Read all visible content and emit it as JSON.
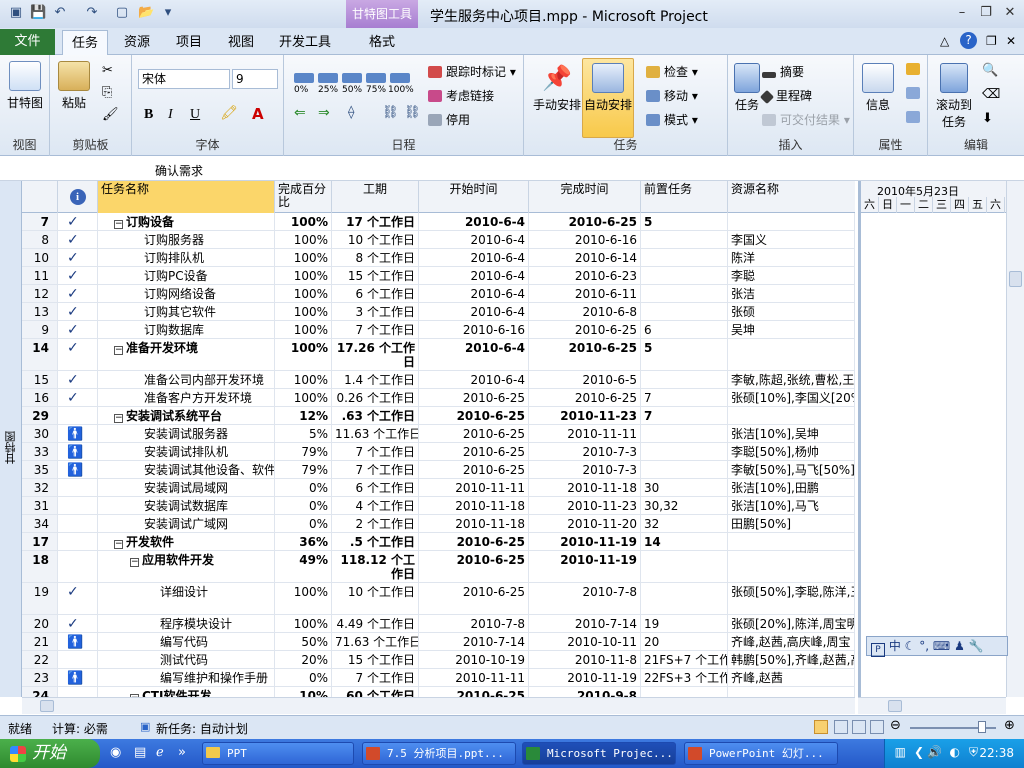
{
  "window": {
    "title": "学生服务中心项目.mpp  -  Microsoft Project",
    "tool_tab": "甘特图工具",
    "minimize": "–",
    "restore": "❐",
    "close": "✕"
  },
  "tabs": {
    "file": "文件",
    "items": [
      "任务",
      "资源",
      "项目",
      "视图",
      "开发工具",
      "格式"
    ],
    "active": "任务"
  },
  "ribbon": {
    "view_group": {
      "label": "视图",
      "gantt": "甘特图"
    },
    "clipboard_group": {
      "label": "剪贴板",
      "paste": "粘贴"
    },
    "font_group": {
      "label": "字体",
      "font_name": "宋体",
      "font_size": "9",
      "bold": "B",
      "italic": "I",
      "underline": "U"
    },
    "schedule_group": {
      "label": "日程",
      "pct": [
        "0%",
        "25%",
        "50%",
        "75%",
        "100%"
      ],
      "track": "跟踪时标记",
      "respect_links": "考虑链接",
      "inactivate": "停用"
    },
    "tasks_group": {
      "label": "任务",
      "manual": "手动安排",
      "auto": "自动安排",
      "inspect": "检查",
      "move": "移动",
      "mode": "模式"
    },
    "insert_group": {
      "label": "插入",
      "task": "任务",
      "summary": "摘要",
      "milestone": "里程碑",
      "deliverable": "可交付结果"
    },
    "properties_group": {
      "label": "属性",
      "info": "信息"
    },
    "editing_group": {
      "label": "编辑",
      "scroll": "滚动到",
      "scroll2": "任务"
    }
  },
  "entry_bar": {
    "value": "确认需求"
  },
  "side_label": "甘特图",
  "columns": [
    "任务名称",
    "完成百分比",
    "工期",
    "开始时间",
    "完成时间",
    "前置任务",
    "资源名称"
  ],
  "gantt": {
    "week": "2010年5月23日",
    "days": [
      "六",
      "日",
      "一",
      "二",
      "三",
      "四",
      "五",
      "六"
    ]
  },
  "rows": [
    {
      "id": "7",
      "ind": "check",
      "name": "订购设备",
      "lvl": 1,
      "sum": true,
      "pct": "100%",
      "dur": "17 个工作日",
      "start": "2010-6-4",
      "finish": "2010-6-25",
      "pred": "5",
      "res": "",
      "h": 18
    },
    {
      "id": "8",
      "ind": "check",
      "name": "订购服务器",
      "lvl": 2,
      "sum": false,
      "pct": "100%",
      "dur": "10 个工作日",
      "start": "2010-6-4",
      "finish": "2010-6-16",
      "pred": "",
      "res": "李国义",
      "h": 18
    },
    {
      "id": "10",
      "ind": "check",
      "name": "订购排队机",
      "lvl": 2,
      "sum": false,
      "pct": "100%",
      "dur": "8 个工作日",
      "start": "2010-6-4",
      "finish": "2010-6-14",
      "pred": "",
      "res": "陈洋",
      "h": 18
    },
    {
      "id": "11",
      "ind": "check",
      "name": "订购PC设备",
      "lvl": 2,
      "sum": false,
      "pct": "100%",
      "dur": "15 个工作日",
      "start": "2010-6-4",
      "finish": "2010-6-23",
      "pred": "",
      "res": "李聪",
      "h": 18
    },
    {
      "id": "12",
      "ind": "check",
      "name": "订购网络设备",
      "lvl": 2,
      "sum": false,
      "pct": "100%",
      "dur": "6 个工作日",
      "start": "2010-6-4",
      "finish": "2010-6-11",
      "pred": "",
      "res": "张洁",
      "h": 18
    },
    {
      "id": "13",
      "ind": "check",
      "name": "订购其它软件",
      "lvl": 2,
      "sum": false,
      "pct": "100%",
      "dur": "3 个工作日",
      "start": "2010-6-4",
      "finish": "2010-6-8",
      "pred": "",
      "res": "张硕",
      "h": 18
    },
    {
      "id": "9",
      "ind": "check",
      "name": "订购数据库",
      "lvl": 2,
      "sum": false,
      "pct": "100%",
      "dur": "7 个工作日",
      "start": "2010-6-16",
      "finish": "2010-6-25",
      "pred": "6",
      "res": "吴坤",
      "h": 18
    },
    {
      "id": "14",
      "ind": "check",
      "name": "准备开发环境",
      "lvl": 1,
      "sum": true,
      "pct": "100%",
      "dur": "17.26 个工作日",
      "start": "2010-6-4",
      "finish": "2010-6-25",
      "pred": "5",
      "res": "",
      "h": 32
    },
    {
      "id": "15",
      "ind": "check",
      "name": "准备公司内部开发环境",
      "lvl": 2,
      "sum": false,
      "pct": "100%",
      "dur": "1.4 个工作日",
      "start": "2010-6-4",
      "finish": "2010-6-5",
      "pred": "",
      "res": "李敏,陈超,张统,曹松,王",
      "h": 18
    },
    {
      "id": "16",
      "ind": "check",
      "name": "准备客户方开发环境",
      "lvl": 2,
      "sum": false,
      "pct": "100%",
      "dur": "0.26 个工作日",
      "start": "2010-6-25",
      "finish": "2010-6-25",
      "pred": "7",
      "res": "张硕[10%],李国义[20%]",
      "h": 18
    },
    {
      "id": "29",
      "ind": "",
      "name": "安装调试系统平台",
      "lvl": 1,
      "sum": true,
      "pct": "12%",
      "dur": ".63 个工作日",
      "start": "2010-6-25",
      "finish": "2010-11-23",
      "pred": "7",
      "res": "",
      "h": 18
    },
    {
      "id": "30",
      "ind": "person",
      "name": "安装调试服务器",
      "lvl": 2,
      "sum": false,
      "pct": "5%",
      "dur": "11.63 个工作日",
      "start": "2010-6-25",
      "finish": "2010-11-11",
      "pred": "",
      "res": "张洁[10%],吴坤",
      "h": 18
    },
    {
      "id": "33",
      "ind": "person",
      "name": "安装调试排队机",
      "lvl": 2,
      "sum": false,
      "pct": "79%",
      "dur": "7 个工作日",
      "start": "2010-6-25",
      "finish": "2010-7-3",
      "pred": "",
      "res": "李聪[50%],杨帅",
      "h": 18
    },
    {
      "id": "35",
      "ind": "person",
      "name": "安装调试其他设备、软件",
      "lvl": 2,
      "sum": false,
      "pct": "79%",
      "dur": "7 个工作日",
      "start": "2010-6-25",
      "finish": "2010-7-3",
      "pred": "",
      "res": "李敏[50%],马飞[50%]",
      "h": 18
    },
    {
      "id": "32",
      "ind": "",
      "name": "安装调试局域网",
      "lvl": 2,
      "sum": false,
      "pct": "0%",
      "dur": "6 个工作日",
      "start": "2010-11-11",
      "finish": "2010-11-18",
      "pred": "30",
      "res": "张洁[10%],田鹏",
      "h": 18
    },
    {
      "id": "31",
      "ind": "",
      "name": "安装调试数据库",
      "lvl": 2,
      "sum": false,
      "pct": "0%",
      "dur": "4 个工作日",
      "start": "2010-11-18",
      "finish": "2010-11-23",
      "pred": "30,32",
      "res": "张洁[10%],马飞",
      "h": 18
    },
    {
      "id": "34",
      "ind": "",
      "name": "安装调试广域网",
      "lvl": 2,
      "sum": false,
      "pct": "0%",
      "dur": "2 个工作日",
      "start": "2010-11-18",
      "finish": "2010-11-20",
      "pred": "32",
      "res": "田鹏[50%]",
      "h": 18
    },
    {
      "id": "17",
      "ind": "",
      "name": "开发软件",
      "lvl": 1,
      "sum": true,
      "pct": "36%",
      "dur": ".5 个工作日",
      "start": "2010-6-25",
      "finish": "2010-11-19",
      "pred": "14",
      "res": "",
      "h": 18
    },
    {
      "id": "18",
      "ind": "",
      "name": "应用软件开发",
      "lvl": 2,
      "sum": true,
      "pct": "49%",
      "dur": "118.12 个工作日",
      "start": "2010-6-25",
      "finish": "2010-11-19",
      "pred": "",
      "res": "",
      "h": 32
    },
    {
      "id": "19",
      "ind": "check",
      "name": "详细设计",
      "lvl": 3,
      "sum": false,
      "pct": "100%",
      "dur": "10 个工作日",
      "start": "2010-6-25",
      "finish": "2010-7-8",
      "pred": "",
      "res": "张硕[50%],李聪,陈洋,王",
      "h": 32
    },
    {
      "id": "20",
      "ind": "check",
      "name": "程序模块设计",
      "lvl": 3,
      "sum": false,
      "pct": "100%",
      "dur": "4.49 个工作日",
      "start": "2010-7-8",
      "finish": "2010-7-14",
      "pred": "19",
      "res": "张硕[20%],陈洋,周宝明",
      "h": 18
    },
    {
      "id": "21",
      "ind": "person",
      "name": "编写代码",
      "lvl": 3,
      "sum": false,
      "pct": "50%",
      "dur": "71.63 个工作日",
      "start": "2010-7-14",
      "finish": "2010-10-11",
      "pred": "20",
      "res": "齐峰,赵茜,高庆峰,周宝",
      "h": 18
    },
    {
      "id": "22",
      "ind": "",
      "name": "测试代码",
      "lvl": 3,
      "sum": false,
      "pct": "20%",
      "dur": "15 个工作日",
      "start": "2010-10-19",
      "finish": "2010-11-8",
      "pred": "21FS+7 个工作日",
      "res": "韩鹏[50%],齐峰,赵茜,高",
      "h": 18
    },
    {
      "id": "23",
      "ind": "person",
      "name": "编写维护和操作手册",
      "lvl": 3,
      "sum": false,
      "pct": "0%",
      "dur": "7 个工作日",
      "start": "2010-11-11",
      "finish": "2010-11-19",
      "pred": "22FS+3 个工作日",
      "res": "齐峰,赵茜",
      "h": 18
    },
    {
      "id": "24",
      "ind": "",
      "name": "CTI软件开发",
      "lvl": 2,
      "sum": true,
      "pct": "10%",
      "dur": "60 个工作日",
      "start": "2010-6-25",
      "finish": "2010-9-8",
      "pred": "",
      "res": "",
      "h": 18
    }
  ],
  "ime": {
    "label": "中"
  },
  "status": {
    "ready": "就绪",
    "calc": "计算: 必需",
    "new_task": "新任务: 自动计划"
  },
  "taskbar": {
    "start": "开始",
    "items": [
      "PPT",
      "7.5 分析项目.ppt...",
      "Microsoft Projec...",
      "PowerPoint 幻灯..."
    ],
    "clock": "22:38"
  },
  "icons": {
    "check": "✓",
    "person": "🚹",
    "collapse": "−"
  }
}
